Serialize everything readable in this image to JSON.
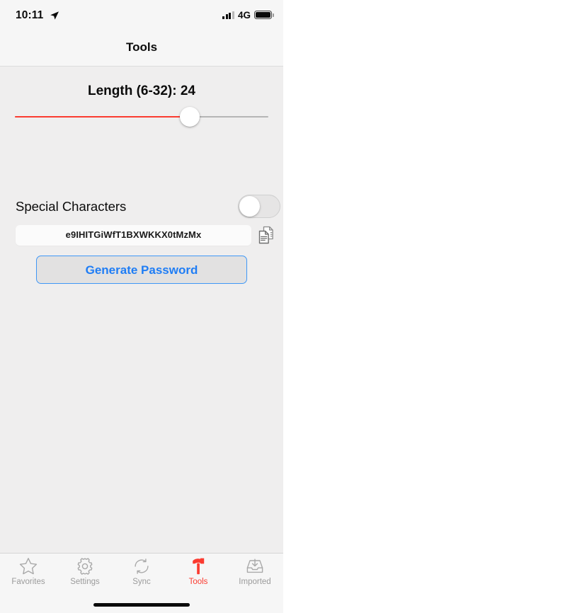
{
  "status_bar": {
    "time": "10:11",
    "location_icon": "location-arrow-icon",
    "signal_icon": "signal-bars-icon",
    "network": "4G",
    "battery_icon": "battery-full-icon"
  },
  "nav": {
    "title": "Tools"
  },
  "main": {
    "length_label": "Length (6-32): 24",
    "length": {
      "value": 24,
      "min": 6,
      "max": 32,
      "percent": 69,
      "track_color": "#fb3b30"
    },
    "special_characters": {
      "label": "Special Characters",
      "enabled": false
    },
    "password": {
      "value": "e9IHITGiWfT1BXWKKX0tMzMx",
      "copy_icon": "copy-icon"
    },
    "generate_button": {
      "label": "Generate Password",
      "text_color": "#1f7df5",
      "border_color": "#3f97f6"
    }
  },
  "tab_bar": {
    "active_color": "#fb3b30",
    "inactive_color": "#9b9b9b",
    "items": [
      {
        "label": "Favorites",
        "icon": "star-icon",
        "active": false
      },
      {
        "label": "Settings",
        "icon": "gear-icon",
        "active": false
      },
      {
        "label": "Sync",
        "icon": "sync-icon",
        "active": false
      },
      {
        "label": "Tools",
        "icon": "hammer-icon",
        "active": true
      },
      {
        "label": "Imported",
        "icon": "inbox-download-icon",
        "active": false
      }
    ]
  }
}
